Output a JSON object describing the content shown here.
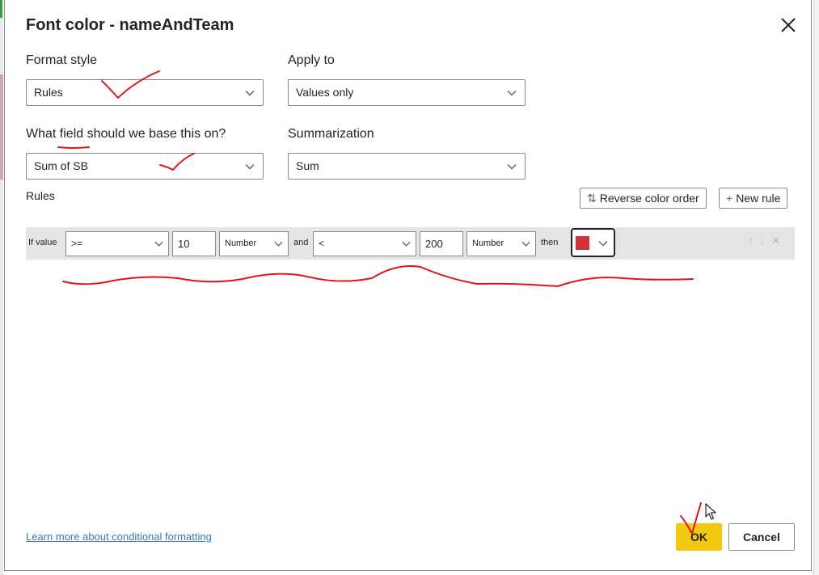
{
  "dialog": {
    "title": "Font color - nameAndTeam",
    "close_icon": "close-icon"
  },
  "format_style": {
    "label": "Format style",
    "value": "Rules"
  },
  "apply_to": {
    "label": "Apply to",
    "value": "Values only"
  },
  "base_field": {
    "label": "What field should we base this on?",
    "value": "Sum of SB"
  },
  "summarization": {
    "label": "Summarization",
    "value": "Sum"
  },
  "rules": {
    "label": "Rules",
    "reverse_button": {
      "icon": "⇅",
      "label": "Reverse color order"
    },
    "new_rule_button": {
      "icon": "+",
      "label": "New rule"
    },
    "rule1": {
      "if_value": "If value",
      "op1": ">=",
      "val1": "10",
      "type1": "Number",
      "and": "and",
      "op2": "<",
      "val2": "200",
      "type2": "Number",
      "then": "then",
      "color": "#d13438",
      "icons": {
        "up": "↑",
        "down": "↓",
        "delete": "✕"
      }
    }
  },
  "footer": {
    "learn_link": "Learn more about conditional formatting",
    "ok_label": "OK",
    "cancel_label": "Cancel"
  },
  "colors": {
    "ok_button": "#f2c811",
    "link": "#3a76b8",
    "annotation_ink": "#e0141b",
    "rule_row_bg": "#e5e5e5"
  }
}
